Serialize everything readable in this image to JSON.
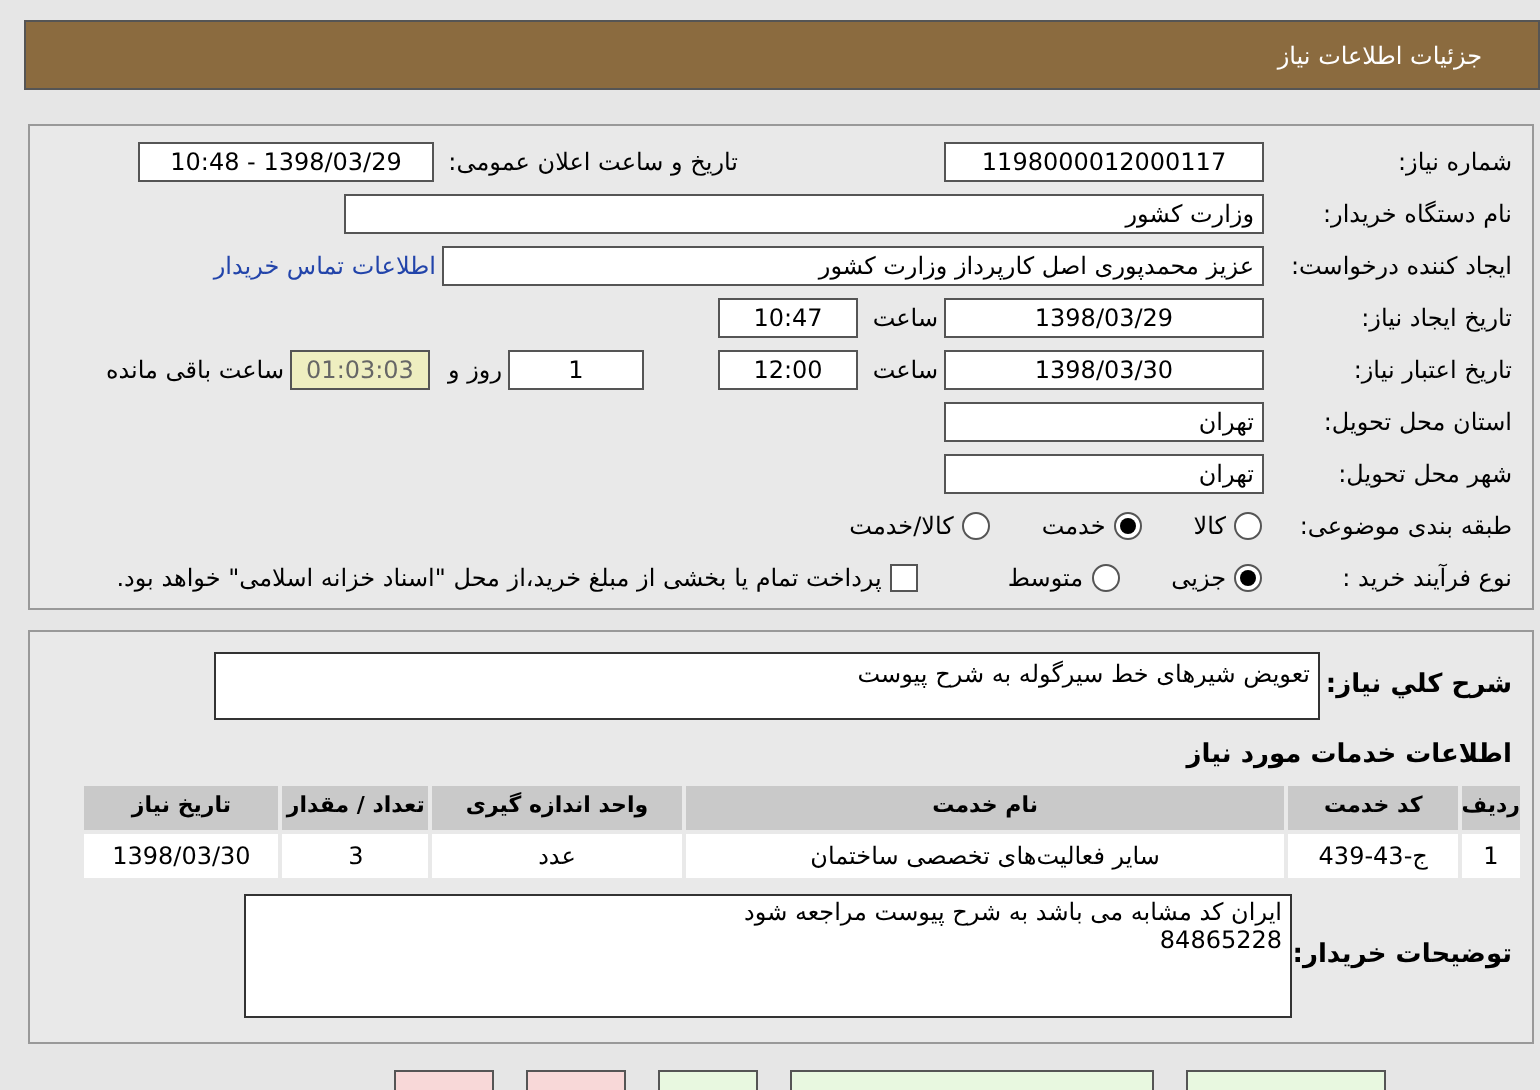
{
  "header": {
    "title": "جزئیات اطلاعات نیاز"
  },
  "details": {
    "need_number": {
      "label": "شماره نیاز:",
      "value": "1198000012000117"
    },
    "announce": {
      "label": "تاریخ و ساعت اعلان عمومی:",
      "value": "1398/03/29 - 10:48"
    },
    "buyer_org": {
      "label": "نام دستگاه خریدار:",
      "value": "وزارت کشور"
    },
    "creator": {
      "label": "ایجاد کننده درخواست:",
      "value": "عزیز محمدپوری اصل کارپرداز وزارت کشور",
      "link": "اطلاعات تماس خریدار"
    },
    "created": {
      "label": "تاریخ ایجاد نیاز:",
      "date": "1398/03/29",
      "time_label": "ساعت",
      "time": "10:47"
    },
    "validity": {
      "label": "تاریخ اعتبار نیاز:",
      "date": "1398/03/30",
      "time_label": "ساعت",
      "time": "12:00",
      "days": "1",
      "days_label": "روز و",
      "remaining": "01:03:03",
      "remaining_label": "ساعت باقی مانده"
    },
    "province": {
      "label": "استان محل تحویل:",
      "value": "تهران"
    },
    "city": {
      "label": "شهر محل تحویل:",
      "value": "تهران"
    },
    "category": {
      "label": "طبقه بندی موضوعی:",
      "options": [
        {
          "label": "کالا",
          "selected": false
        },
        {
          "label": "خدمت",
          "selected": true
        },
        {
          "label": "کالا/خدمت",
          "selected": false
        }
      ]
    },
    "process": {
      "label": "نوع فرآیند خرید :",
      "options": [
        {
          "label": "جزیی",
          "selected": true
        },
        {
          "label": "متوسط",
          "selected": false
        }
      ],
      "treasury": {
        "checked": false,
        "label": "پرداخت تمام یا بخشی از مبلغ خرید،از محل \"اسناد خزانه اسلامی\" خواهد بود."
      }
    }
  },
  "summary": {
    "label": "شرح کلي نياز:",
    "value": "تعویض شیرهای خط سیرگوله به شرح پیوست"
  },
  "services": {
    "title": "اطلاعات خدمات مورد نیاز",
    "columns": [
      "ردیف",
      "کد خدمت",
      "نام خدمت",
      "واحد اندازه گیری",
      "تعداد / مقدار",
      "تاریخ نیاز"
    ],
    "rows": [
      [
        "1",
        "ج-43-439",
        "سایر فعالیت‌های تخصصی ساختمان",
        "عدد",
        "3",
        "1398/03/30"
      ]
    ]
  },
  "buyer_notes": {
    "label": "توضیحات خریدار:",
    "lines": [
      "ایران کد مشابه می باشد به شرح پیوست مراجعه شود",
      "84865228"
    ]
  },
  "buttons": [
    {
      "kind": "green"
    },
    {
      "kind": "green"
    },
    {
      "kind": "green"
    },
    {
      "kind": "red"
    },
    {
      "kind": "red"
    }
  ]
}
